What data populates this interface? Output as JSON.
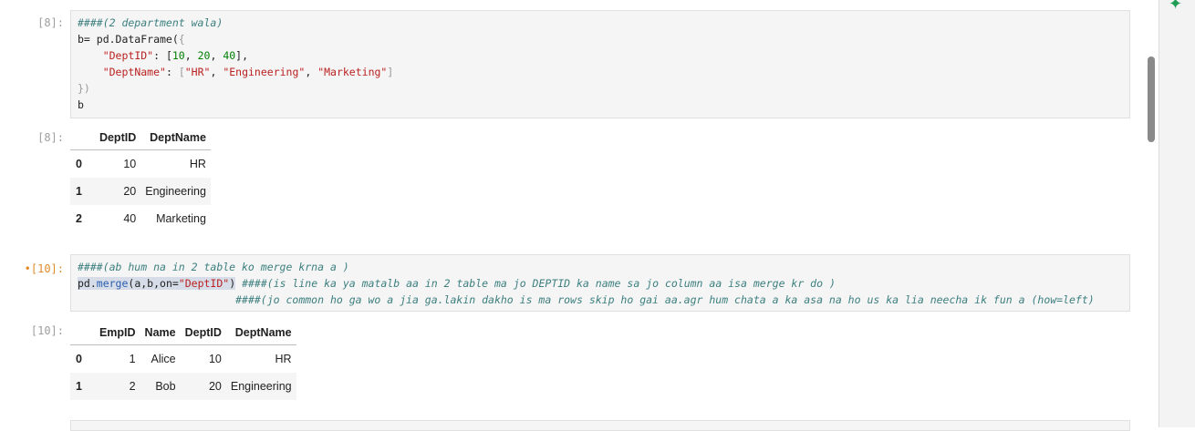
{
  "cells": [
    {
      "prompt": "[8]:",
      "code_lines": [
        [
          {
            "t": "####(2 department wala)",
            "c": "cm"
          }
        ],
        [
          {
            "t": "b= pd.DataFrame(",
            "c": ""
          },
          {
            "t": "{",
            "c": "br"
          }
        ],
        [
          {
            "t": "    ",
            "c": ""
          },
          {
            "t": "\"DeptID\"",
            "c": "str"
          },
          {
            "t": ": [",
            "c": ""
          },
          {
            "t": "10",
            "c": "num"
          },
          {
            "t": ", ",
            "c": ""
          },
          {
            "t": "20",
            "c": "num"
          },
          {
            "t": ", ",
            "c": ""
          },
          {
            "t": "40",
            "c": "num"
          },
          {
            "t": "],",
            "c": ""
          }
        ],
        [
          {
            "t": "    ",
            "c": ""
          },
          {
            "t": "\"DeptName\"",
            "c": "str"
          },
          {
            "t": ": ",
            "c": ""
          },
          {
            "t": "[",
            "c": "br"
          },
          {
            "t": "\"HR\"",
            "c": "str"
          },
          {
            "t": ", ",
            "c": ""
          },
          {
            "t": "\"Engineering\"",
            "c": "str"
          },
          {
            "t": ", ",
            "c": ""
          },
          {
            "t": "\"Marketing\"",
            "c": "str"
          },
          {
            "t": "]",
            "c": "br"
          }
        ],
        [
          {
            "t": "})",
            "c": "br"
          }
        ],
        [
          {
            "t": "b",
            "c": ""
          }
        ]
      ],
      "output_prompt": "[8]:",
      "table": {
        "columns": [
          "DeptID",
          "DeptName"
        ],
        "rows": [
          {
            "index": "0",
            "values": [
              "10",
              "HR"
            ]
          },
          {
            "index": "1",
            "values": [
              "20",
              "Engineering"
            ]
          },
          {
            "index": "2",
            "values": [
              "40",
              "Marketing"
            ]
          }
        ]
      }
    },
    {
      "prompt": "•[10]:",
      "code_lines": [
        [
          {
            "t": "####(ab hum na in 2 table ko merge krna a )",
            "c": "cm"
          }
        ],
        [
          {
            "t": "pd.",
            "c": "sel"
          },
          {
            "t": "merge",
            "c": "sel fn"
          },
          {
            "t": "(a,b,on=",
            "c": "sel"
          },
          {
            "t": "\"DeptID\"",
            "c": "sel str"
          },
          {
            "t": ")",
            "c": "sel"
          },
          {
            "t": " ",
            "c": ""
          },
          {
            "t": "####(is line ka ya matalb aa in 2 table ma jo DEPTID ka name sa jo column aa isa merge kr do )",
            "c": "cm"
          }
        ],
        [
          {
            "t": "                         ",
            "c": ""
          },
          {
            "t": "####(jo common ho ga wo a jia ga.lakin dakho is ma rows skip ho gai aa.agr hum chata a ka asa na ho us ka lia neecha ik fun a (how=left)",
            "c": "cm"
          }
        ]
      ],
      "output_prompt": "[10]:",
      "table": {
        "columns": [
          "EmpID",
          "Name",
          "DeptID",
          "DeptName"
        ],
        "rows": [
          {
            "index": "0",
            "values": [
              "1",
              "Alice",
              "10",
              "HR"
            ]
          },
          {
            "index": "1",
            "values": [
              "2",
              "Bob",
              "20",
              "Engineering"
            ]
          }
        ]
      }
    }
  ],
  "side_icon": "sparkle-icon",
  "colors": {
    "accent": "#1f9d55",
    "busy_prompt": "#e08c2c"
  }
}
